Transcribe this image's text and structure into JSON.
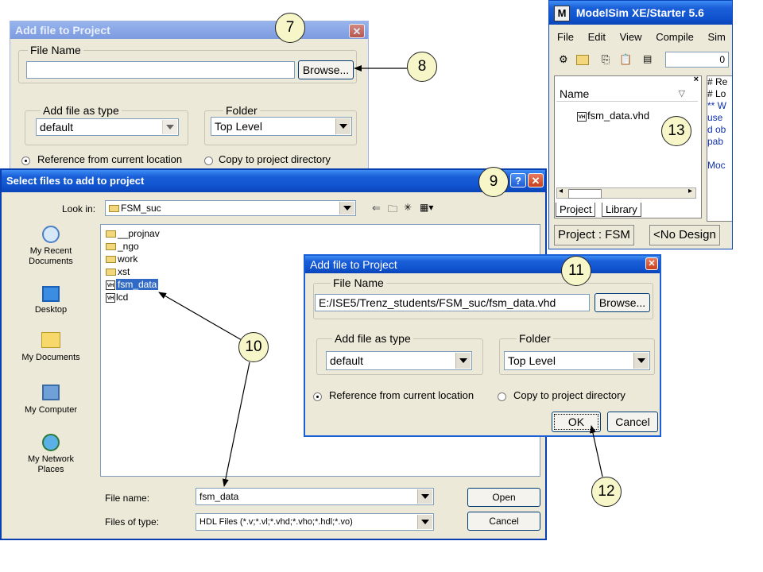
{
  "dialog_back": {
    "title": "Add file to Project",
    "file_name_legend": "File Name",
    "browse_label": "Browse...",
    "type_legend": "Add file as type",
    "type_value": "default",
    "folder_legend": "Folder",
    "folder_value": "Top Level",
    "radio_reference": "Reference from current location",
    "radio_copy": "Copy to project directory"
  },
  "select_dialog": {
    "title": "Select files to add to project",
    "lookin_label": "Look in:",
    "lookin_value": "FSM_suc",
    "places": [
      "My Recent Documents",
      "Desktop",
      "My Documents",
      "My Computer",
      "My Network Places"
    ],
    "files": [
      {
        "name": "__projnav",
        "kind": "folder"
      },
      {
        "name": "_ngo",
        "kind": "folder"
      },
      {
        "name": "work",
        "kind": "folder"
      },
      {
        "name": "xst",
        "kind": "folder"
      },
      {
        "name": "fsm_data",
        "kind": "vhd",
        "selected": true
      },
      {
        "name": "lcd",
        "kind": "vhd"
      }
    ],
    "filename_label": "File name:",
    "filename_value": "fsm_data",
    "filetype_label": "Files of type:",
    "filetype_value": "HDL Files (*.v;*.vl;*.vhd;*.vho;*.hdl;*.vo)",
    "open_label": "Open",
    "cancel_label": "Cancel"
  },
  "dialog_front": {
    "title": "Add file to Project",
    "file_name_legend": "File Name",
    "file_path": "E:/ISE5/Trenz_students/FSM_suc/fsm_data.vhd",
    "browse_label": "Browse...",
    "type_legend": "Add file as type",
    "type_value": "default",
    "folder_legend": "Folder",
    "folder_value": "Top Level",
    "radio_reference": "Reference from current location",
    "radio_copy": "Copy to project directory",
    "ok_label": "OK",
    "cancel_label": "Cancel"
  },
  "modelsim": {
    "title": "ModelSim XE/Starter 5.6",
    "menu": [
      "File",
      "Edit",
      "View",
      "Compile",
      "Sim"
    ],
    "toolbar_value": "0",
    "workspace_column": "Name",
    "workspace_item": "fsm_data.vhd",
    "tabs": [
      "Project",
      "Library"
    ],
    "status_project": "Project : FSM",
    "status_design": "<No Design",
    "transcript_lines": [
      "# Re",
      "# Lo",
      "** W",
      " use",
      "d ob",
      "pab",
      "",
      "Moc"
    ]
  },
  "callouts": [
    "7",
    "8",
    "9",
    "10",
    "11",
    "12",
    "13"
  ],
  "colors": {
    "title_active": "#1154d0",
    "title_inactive": "#7c9be0",
    "dialog_bg": "#ece9d8",
    "callout_fill": "#f6f6c8",
    "selection": "#316ac5"
  }
}
